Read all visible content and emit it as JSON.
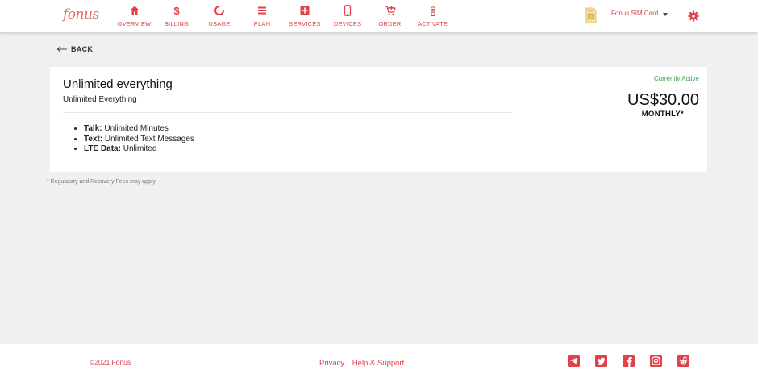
{
  "brand": {
    "logo": "fonus",
    "accent": "#e0414a",
    "status_color": "#3aa04a"
  },
  "nav": [
    {
      "label": "OVERVIEW",
      "icon": "home-icon"
    },
    {
      "label": "BILLING",
      "icon": "dollar-icon"
    },
    {
      "label": "USAGE",
      "icon": "donut-chart-icon"
    },
    {
      "label": "PLAN",
      "icon": "list-icon"
    },
    {
      "label": "SERVICES",
      "icon": "plus-box-icon"
    },
    {
      "label": "DEVICES",
      "icon": "phone-icon"
    },
    {
      "label": "ORDER",
      "icon": "cart-icon"
    },
    {
      "label": "ACTIVATE",
      "icon": "signal-icon"
    }
  ],
  "account": {
    "sim_label": "Fonus SIM Card",
    "sim_icon": "sim-card-icon",
    "settings_icon": "gear-icon"
  },
  "back": {
    "label": "BACK"
  },
  "plan": {
    "name": "Unlimited everything",
    "subtitle": "Unlimited Everything",
    "features": [
      {
        "label": "Talk:",
        "value": " Unlimited Minutes"
      },
      {
        "label": "Text:",
        "value": " Unlimited Text Messages"
      },
      {
        "label": "LTE Data:",
        "value": " Unlimited"
      }
    ],
    "status": "Currently Active",
    "price": "US$30.00",
    "period": "MONTHLY*"
  },
  "note": "* Regulatory and Recovery Fees may apply.",
  "footer": {
    "copyright": "©2021 Fonus",
    "links": [
      "Privacy",
      "Help & Support"
    ],
    "social": [
      "telegram-icon",
      "twitter-icon",
      "facebook-icon",
      "instagram-icon",
      "reddit-icon"
    ]
  }
}
